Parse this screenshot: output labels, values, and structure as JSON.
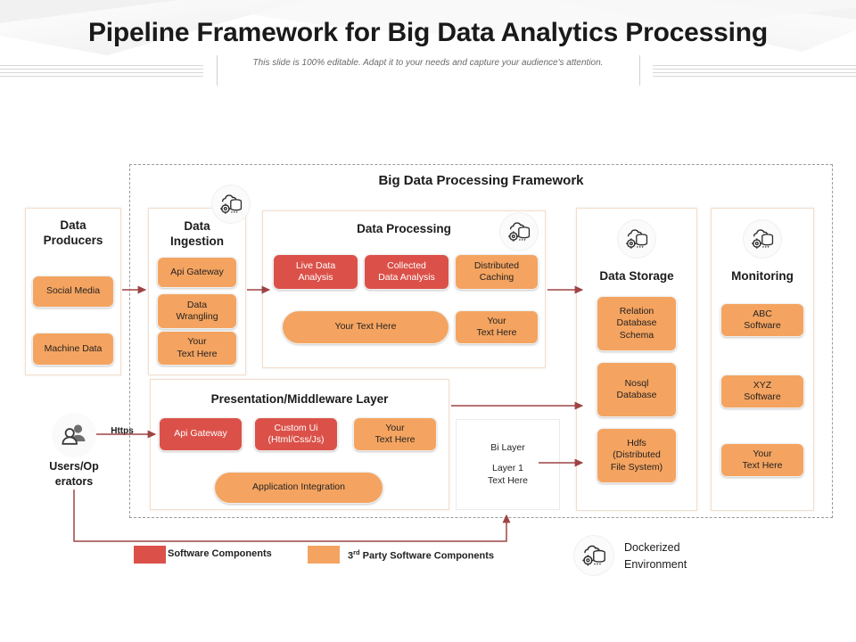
{
  "header": {
    "title": "Pipeline Framework for Big Data Analytics Processing",
    "subtitle": "This slide is 100% editable. Adapt it to your needs and capture your audience's attention."
  },
  "framework": {
    "title": "Big Data Processing Framework"
  },
  "users": {
    "label_line1": "Users/Op",
    "label_line2": "erators",
    "protocol": "Https",
    "icon": "users-icon"
  },
  "columns": {
    "data_producers": {
      "title": "Data\nProducers",
      "title_line1": "Data",
      "title_line2": "Producers",
      "items": [
        {
          "label": "Social Media",
          "color": "orange"
        },
        {
          "label": "Machine Data",
          "color": "orange"
        }
      ]
    },
    "data_ingestion": {
      "title_line1": "Data",
      "title_line2": "Ingestion",
      "icon": "dockerized-cloud-database-icon",
      "items": [
        {
          "label": "Api Gateway",
          "color": "orange"
        },
        {
          "label": "Data\nWrangling",
          "color": "orange",
          "line1": "Data",
          "line2": "Wrangling"
        },
        {
          "label": "Your\nText Here",
          "color": "orange",
          "line1": "Your",
          "line2": "Text Here"
        }
      ]
    },
    "data_processing": {
      "title": "Data Processing",
      "icon": "dockerized-cloud-database-icon",
      "items": [
        {
          "label": "Live Data\nAnalysis",
          "color": "red",
          "line1": "Live Data",
          "line2": "Analysis"
        },
        {
          "label": "Collected\nData Analysis",
          "color": "red",
          "line1": "Collected",
          "line2": "Data Analysis"
        },
        {
          "label": "Distributed\nCaching",
          "color": "orange",
          "line1": "Distributed",
          "line2": "Caching"
        },
        {
          "label": "Your Text Here",
          "color": "orange",
          "shape": "pill"
        },
        {
          "label": "Your\nText Here",
          "color": "orange",
          "line1": "Your",
          "line2": "Text Here"
        }
      ]
    },
    "data_storage": {
      "title": "Data Storage",
      "icon": "dockerized-cloud-database-icon",
      "items": [
        {
          "label": "Relation\nDatabase\nSchema",
          "color": "orange",
          "line1": "Relation",
          "line2": "Database",
          "line3": "Schema"
        },
        {
          "label": "Nosql\nDatabase",
          "color": "orange",
          "line1": "Nosql",
          "line2": "Database"
        },
        {
          "label": "Hdfs\n(Distributed\nFile System)",
          "color": "orange",
          "line1": "Hdfs",
          "line2": "(Distributed",
          "line3": "File System)"
        }
      ]
    },
    "monitoring": {
      "title": "Monitoring",
      "icon": "dockerized-cloud-database-icon",
      "items": [
        {
          "label": "ABC\nSoftware",
          "color": "orange",
          "line1": "ABC",
          "line2": "Software"
        },
        {
          "label": "XYZ\nSoftware",
          "color": "orange",
          "line1": "XYZ",
          "line2": "Software"
        },
        {
          "label": "Your\nText Here",
          "color": "orange",
          "line1": "Your",
          "line2": "Text Here"
        }
      ]
    },
    "presentation": {
      "title": "Presentation/Middleware Layer",
      "items": [
        {
          "label": "Api Gateway",
          "color": "red"
        },
        {
          "label": "Custom Ui\n(Html/Css/Js)",
          "color": "red",
          "line1": "Custom Ui",
          "line2": "(Html/Css/Js)"
        },
        {
          "label": "Your\nText Here",
          "color": "orange",
          "line1": "Your",
          "line2": "Text Here"
        },
        {
          "label": "Application Integration",
          "color": "orange",
          "shape": "pill"
        }
      ]
    },
    "bi_layer": {
      "line1": "Bi Layer",
      "line2": "Layer 1",
      "line3": "Text Here"
    }
  },
  "legend": {
    "items": [
      {
        "label": "Software Components",
        "color": "#DB5149"
      },
      {
        "label_prefix": "3",
        "label_sup": "rd",
        "label_rest": " Party  Software  Components",
        "color": "#F4A460"
      }
    ],
    "docker": {
      "line1": "Dockerized",
      "line2": "Environment",
      "icon": "dockerized-cloud-database-icon"
    }
  },
  "colors": {
    "red": "#DB5149",
    "orange": "#F4A460",
    "arrow": "#9E4343",
    "panel_border": "#F3DDCB",
    "dashed_border": "#9A9A9A",
    "title": "#1A1A1A"
  }
}
